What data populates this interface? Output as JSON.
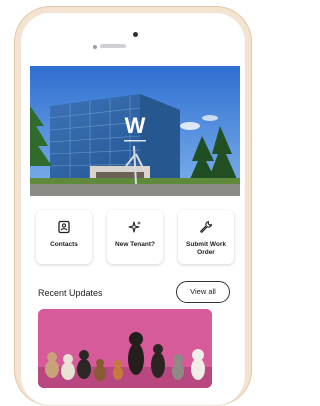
{
  "hero": {
    "logo_letter": "W"
  },
  "actions": [
    {
      "label": "Contacts",
      "icon": "contacts-icon"
    },
    {
      "label": "New Tenant?",
      "icon": "sparkle-icon"
    },
    {
      "label": "Submit Work Order",
      "icon": "wrench-icon"
    }
  ],
  "updates": {
    "title": "Recent Updates",
    "view_all_label": "View all"
  },
  "colors": {
    "frame": "#f3e3cf",
    "sky": "#2f6fd1",
    "card_background": "#d75a9b"
  }
}
